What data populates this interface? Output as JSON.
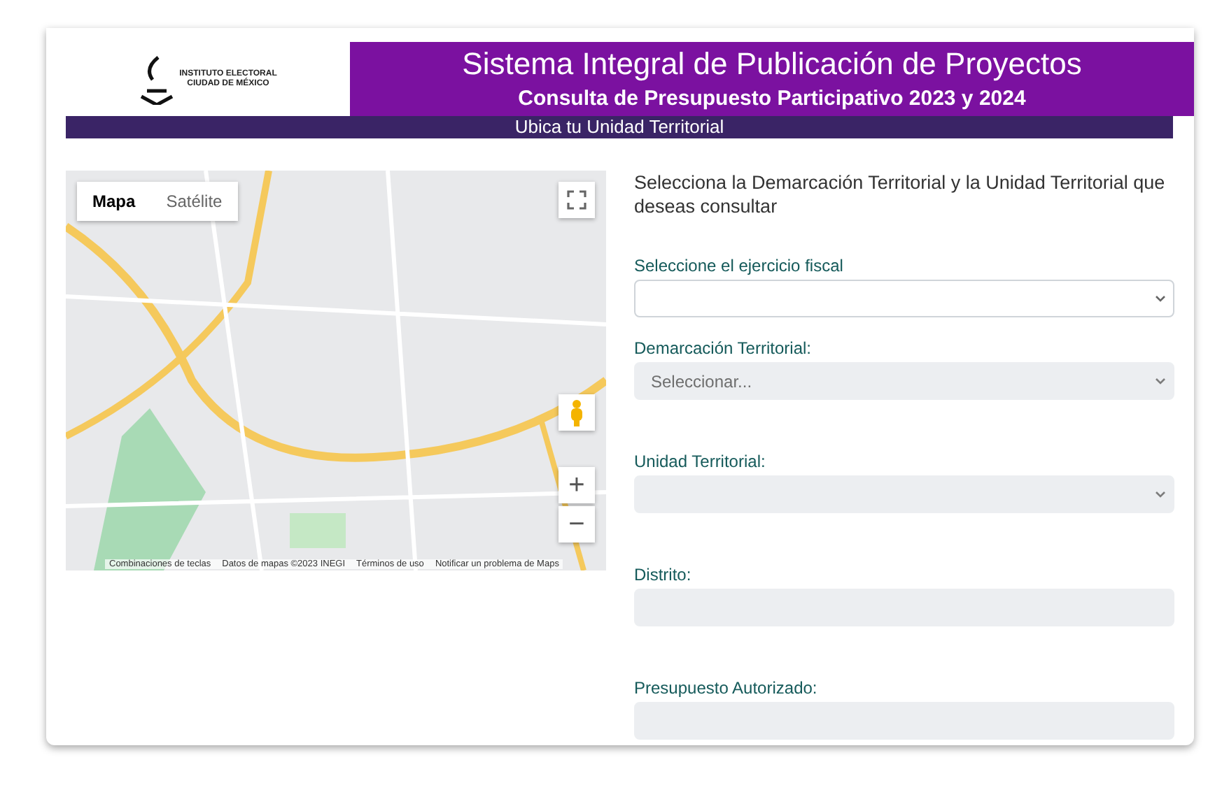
{
  "header": {
    "logo_text": "INSTITUTO ELECTORAL CIUDAD DE MÉXICO",
    "title": "Sistema Integral de Publicación de Proyectos",
    "subtitle": "Consulta de Presupuesto Participativo 2023 y 2024"
  },
  "section_bar": "Ubica tu Unidad Territorial",
  "map": {
    "tabs": [
      {
        "label": "Mapa",
        "selected": true
      },
      {
        "label": "Satélite",
        "selected": false
      }
    ],
    "zoom_in": "+",
    "zoom_out": "−",
    "attribution": [
      "Combinaciones de teclas",
      "Datos de mapas ©2023 INEGI",
      "Términos de uso",
      "Notificar un problema de Maps"
    ]
  },
  "form": {
    "intro": "Selecciona la Demarcación Territorial y la Unidad Territorial que deseas consultar",
    "fields": [
      {
        "label": "Seleccione el ejercicio fiscal",
        "kind": "select",
        "disabled": false
      },
      {
        "label": "Demarcación Territorial:",
        "kind": "select",
        "disabled": true,
        "placeholder": "Seleccionar..."
      },
      {
        "label": "Unidad Territorial:",
        "kind": "select",
        "disabled": true
      },
      {
        "label": "Distrito:",
        "kind": "text",
        "disabled": true
      },
      {
        "label": "Presupuesto Autorizado:",
        "kind": "text",
        "disabled": true
      }
    ]
  }
}
